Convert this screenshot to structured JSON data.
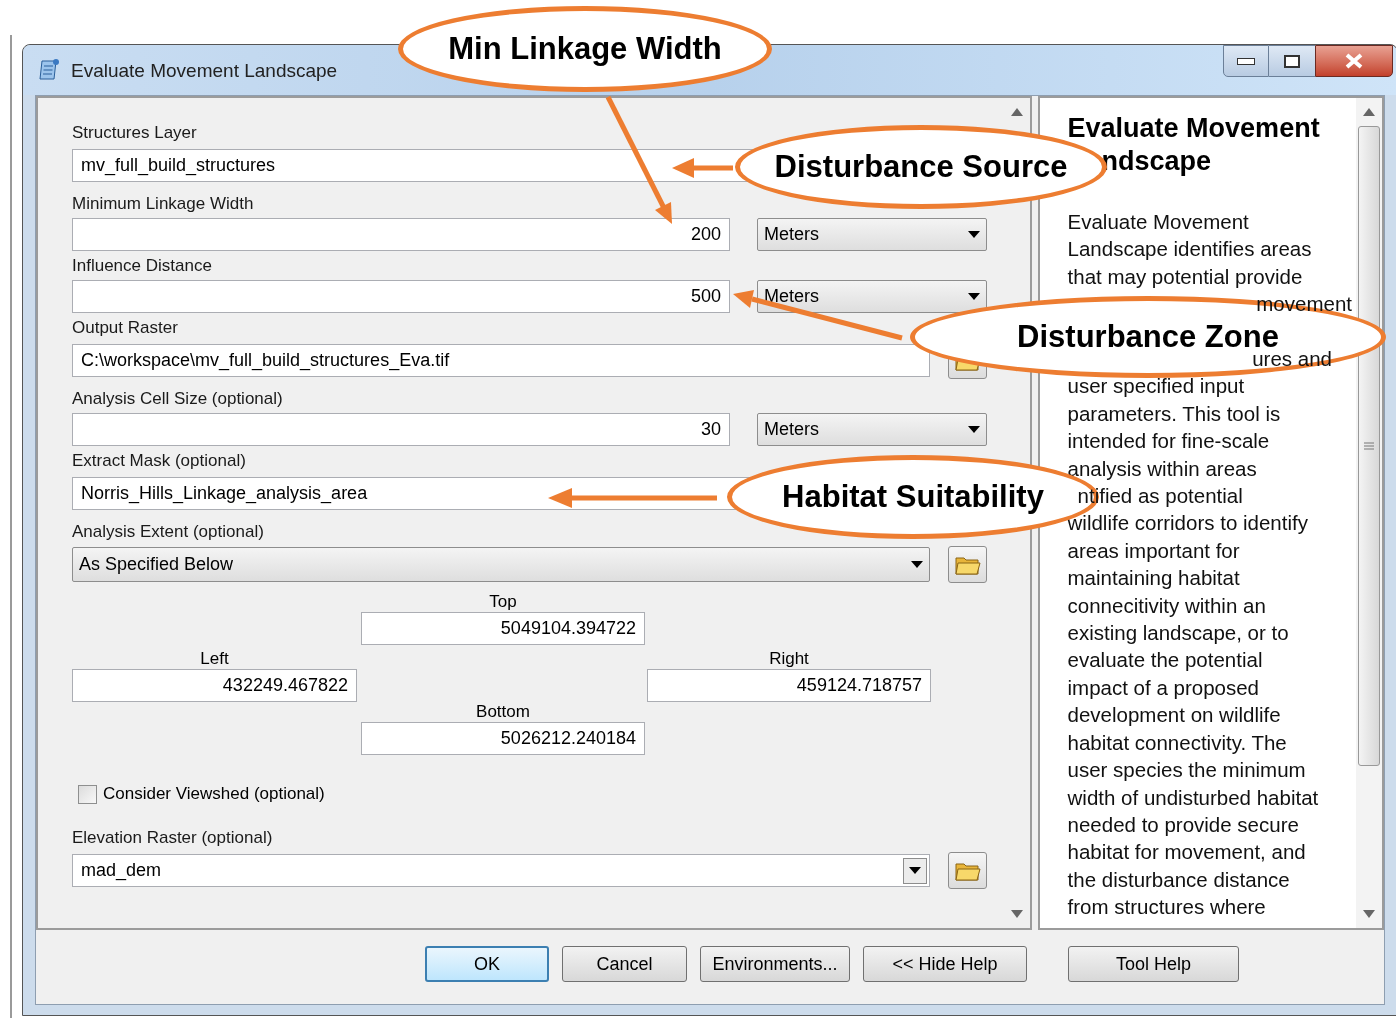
{
  "window": {
    "title": "Evaluate Movement Landscape"
  },
  "params": [
    {
      "kind": "text",
      "label": "Structures Layer",
      "value": "mv_full_build_structures",
      "browse": false
    },
    {
      "kind": "number",
      "label": "Minimum Linkage Width",
      "value": "200",
      "unit": "Meters"
    },
    {
      "kind": "number",
      "label": "Influence Distance",
      "value": "500",
      "unit": "Meters"
    },
    {
      "kind": "text",
      "label": "Output Raster",
      "value": "C:\\workspace\\mv_full_build_structures_Eva.tif",
      "browse": true
    },
    {
      "kind": "number",
      "label": "Analysis Cell Size (optional)",
      "value": "30",
      "unit": "Meters"
    },
    {
      "kind": "text",
      "label": "Extract Mask (optional)",
      "value": "Norris_Hills_Linkage_analysis_area",
      "browse": false
    },
    {
      "kind": "select",
      "label": "Analysis Extent (optional)",
      "value": "As Specified Below",
      "browse": true
    },
    {
      "kind": "extent",
      "top": {
        "label": "Top",
        "value": "5049104.394722"
      },
      "left": {
        "label": "Left",
        "value": "432249.467822"
      },
      "right": {
        "label": "Right",
        "value": "459124.718757"
      },
      "bottom": {
        "label": "Bottom",
        "value": "5026212.240184"
      }
    },
    {
      "kind": "checkbox",
      "label": "Consider Viewshed (optional)",
      "checked": false
    },
    {
      "kind": "combo",
      "label": "Elevation Raster (optional)",
      "value": "mad_dem",
      "browse": true
    }
  ],
  "help": {
    "heading": [
      {
        "kind": "line",
        "text": "Evaluate Movement"
      },
      {
        "kind": "clipped",
        "text": "ndscape"
      }
    ],
    "lines": [
      {
        "kind": "line",
        "text": "Evaluate Movement"
      },
      {
        "kind": "line",
        "text": "Landscape identifies areas"
      },
      {
        "kind": "line",
        "text": "that may potential provide"
      },
      {
        "kind": "tail",
        "text": "movement"
      },
      {
        "kind": "covered-tail",
        "text": "ures and"
      },
      {
        "kind": "line",
        "text": "user specified input"
      },
      {
        "kind": "line",
        "text": "parameters. This tool is"
      },
      {
        "kind": "line",
        "text": "intended for fine-scale"
      },
      {
        "kind": "line",
        "text": "analysis within areas"
      },
      {
        "kind": "clipped",
        "text": "ntified as potential"
      },
      {
        "kind": "line",
        "text": "wildlife corridors to identify"
      },
      {
        "kind": "line",
        "text": "areas important for"
      },
      {
        "kind": "line",
        "text": "maintaining habitat"
      },
      {
        "kind": "line",
        "text": "connecitivity within an"
      },
      {
        "kind": "line",
        "text": "existing landscape, or to"
      },
      {
        "kind": "line",
        "text": "evaluate the potential"
      },
      {
        "kind": "line",
        "text": "impact of a proposed"
      },
      {
        "kind": "line",
        "text": "development on wildlife"
      },
      {
        "kind": "line",
        "text": "habitat connectivity. The"
      },
      {
        "kind": "line",
        "text": "user species the minimum"
      },
      {
        "kind": "line",
        "text": "width of undisturbed habitat"
      },
      {
        "kind": "line",
        "text": "needed to provide secure"
      },
      {
        "kind": "line",
        "text": "habitat for movement, and"
      },
      {
        "kind": "line",
        "text": "the disturbance distance"
      },
      {
        "kind": "line",
        "text": "from structures where"
      }
    ]
  },
  "buttons": [
    {
      "label": "OK",
      "default": true
    },
    {
      "label": "Cancel",
      "default": false
    },
    {
      "label": "Environments...",
      "default": false
    },
    {
      "label": "<< Hide Help",
      "default": false
    },
    {
      "label": "Tool Help",
      "default": false
    }
  ],
  "callouts": [
    {
      "text": "Min Linkage Width"
    },
    {
      "text": "Disturbance Source"
    },
    {
      "text": "Disturbance Zone"
    },
    {
      "text": "Habitat Suitability"
    }
  ]
}
